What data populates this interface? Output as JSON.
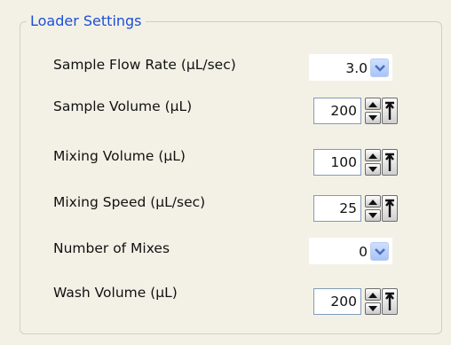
{
  "group": {
    "title": "Loader Settings"
  },
  "rows": [
    {
      "label": "Sample Flow Rate (µL/sec)",
      "value": "3.0",
      "control": "combo"
    },
    {
      "label": "Sample Volume (µL)",
      "value": "200",
      "control": "spin"
    },
    {
      "label": "Mixing Volume (µL)",
      "value": "100",
      "control": "spin"
    },
    {
      "label": "Mixing Speed (µL/sec)",
      "value": "25",
      "control": "spin"
    },
    {
      "label": "Number of Mixes",
      "value": "0",
      "control": "combo"
    },
    {
      "label": "Wash Volume (µL)",
      "value": "200",
      "control": "spin"
    }
  ],
  "colors": {
    "title": "#1c4fd8",
    "panel": "#f3f1e6",
    "combo_button": "#a9c4f5"
  },
  "icons": {
    "combo": "chevron-down-icon",
    "spin_up": "triangle-up-icon",
    "spin_down": "triangle-down-icon",
    "max": "arrow-to-top-icon"
  }
}
